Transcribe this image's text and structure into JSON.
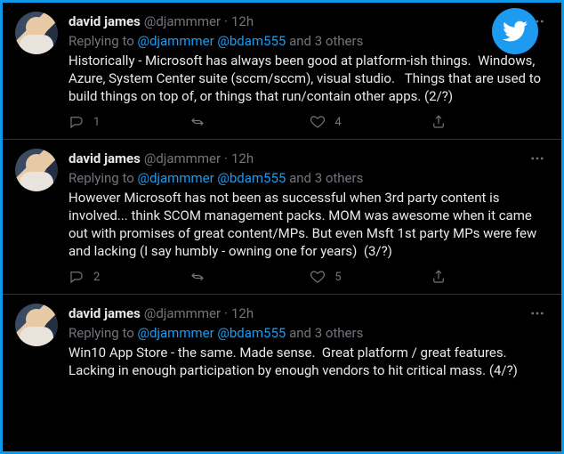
{
  "brand": {
    "logo_name": "twitter-bird-icon"
  },
  "tweets": [
    {
      "author_name": "david james",
      "author_handle": "@djammmer",
      "time_label": "12h",
      "reply_prefix": "Replying to ",
      "mentions": "@djammmer @bdam555",
      "reply_suffix": " and 3 others",
      "body": "Historically - Microsoft has always been good at platform-ish things.  Windows, Azure, System Center suite (sccm/sccm), visual studio.   Things that are used to build things on top of, or things that run/contain other apps. (2/?)",
      "reply_count": "1",
      "retweet_count": "",
      "like_count": "4"
    },
    {
      "author_name": "david james",
      "author_handle": "@djammmer",
      "time_label": "12h",
      "reply_prefix": "Replying to ",
      "mentions": "@djammmer @bdam555",
      "reply_suffix": " and 3 others",
      "body": "However Microsoft has not been as successful when 3rd party content is involved... think SCOM management packs. MOM was awesome when it came out with promises of great content/MPs. But even Msft 1st party MPs were few and lacking (I say humbly - owning one for years)  (3/?)",
      "reply_count": "2",
      "retweet_count": "",
      "like_count": "5"
    },
    {
      "author_name": "david james",
      "author_handle": "@djammmer",
      "time_label": "12h",
      "reply_prefix": "Replying to ",
      "mentions": "@djammmer @bdam555",
      "reply_suffix": " and 3 others",
      "body": "Win10 App Store - the same. Made sense.  Great platform / great features.  Lacking in enough participation by enough vendors to hit critical mass. (4/?)",
      "reply_count": "",
      "retweet_count": "",
      "like_count": ""
    }
  ]
}
